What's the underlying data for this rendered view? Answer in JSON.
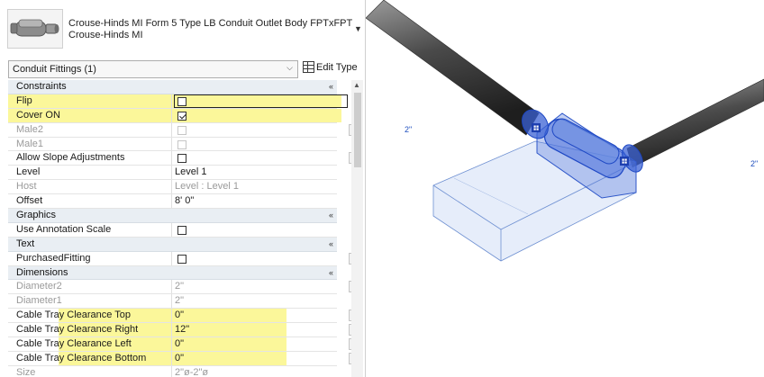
{
  "type_selector": {
    "name_line1": "Crouse-Hinds MI Form 5 Type LB Conduit Outlet Body FPTxFPT",
    "name_line2": "Crouse-Hinds MI"
  },
  "filter": {
    "label": "Conduit Fittings (1)",
    "edit_type_label": "Edit Type"
  },
  "rows": [
    {
      "kind": "group",
      "name": "Constraints",
      "toggle": "«"
    },
    {
      "kind": "prop",
      "name": "Flip",
      "cb": "empty",
      "hl": "full",
      "flip": true
    },
    {
      "kind": "prop",
      "name": "Cover ON",
      "cb": "checked",
      "hl": "full"
    },
    {
      "kind": "prop",
      "name": "Male2",
      "cb": "disabled",
      "disabled": true,
      "btn": true
    },
    {
      "kind": "prop",
      "name": "Male1",
      "cb": "disabled",
      "disabled": true
    },
    {
      "kind": "prop",
      "name": "Allow Slope Adjustments",
      "cb": "empty",
      "btn": true
    },
    {
      "kind": "prop",
      "name": "Level",
      "value": "Level 1"
    },
    {
      "kind": "prop",
      "name": "Host",
      "value": "Level : Level 1",
      "disabled": true
    },
    {
      "kind": "prop",
      "name": "Offset",
      "value": "8'  0\""
    },
    {
      "kind": "group",
      "name": "Graphics",
      "toggle": "«"
    },
    {
      "kind": "prop",
      "name": "Use Annotation Scale",
      "cb": "empty"
    },
    {
      "kind": "group",
      "name": "Text",
      "toggle": "«"
    },
    {
      "kind": "prop",
      "name": "PurchasedFitting",
      "cb": "empty",
      "btn": true
    },
    {
      "kind": "group",
      "name": "Dimensions",
      "toggle": "«"
    },
    {
      "kind": "prop",
      "name": "Diameter2",
      "value": "2\"",
      "disabled": true,
      "btn": true
    },
    {
      "kind": "prop",
      "name": "Diameter1",
      "value": "2\"",
      "disabled": true
    },
    {
      "kind": "prop",
      "name": "Cable Tray Clearance Top",
      "value": "0\"",
      "hl": "part",
      "btn": true
    },
    {
      "kind": "prop",
      "name": "Cable Tray Clearance Right",
      "value": "12\"",
      "hl": "part",
      "btn": true
    },
    {
      "kind": "prop",
      "name": "Cable Tray Clearance Left",
      "value": "0\"",
      "hl": "part",
      "btn": true
    },
    {
      "kind": "prop",
      "name": "Cable Tray Clearance Bottom",
      "value": "0\"",
      "hl": "part",
      "btn": true
    },
    {
      "kind": "prop",
      "name": "Size",
      "value": "2\"ø-2\"ø",
      "disabled": true
    }
  ],
  "icons": {
    "dropdown": "chevron-down-icon",
    "edit_type": "edit-type-icon",
    "collapse": "double-chevron-up-icon",
    "fitting_thumbnail": "conduit-fitting-thumbnail"
  },
  "viewport": {
    "dim_left": "2\"",
    "dim_right": "2\""
  },
  "colors": {
    "highlight": "#fbf79a",
    "selection_blue": "#3a64d8",
    "group_header_bg": "#e9eef3"
  }
}
